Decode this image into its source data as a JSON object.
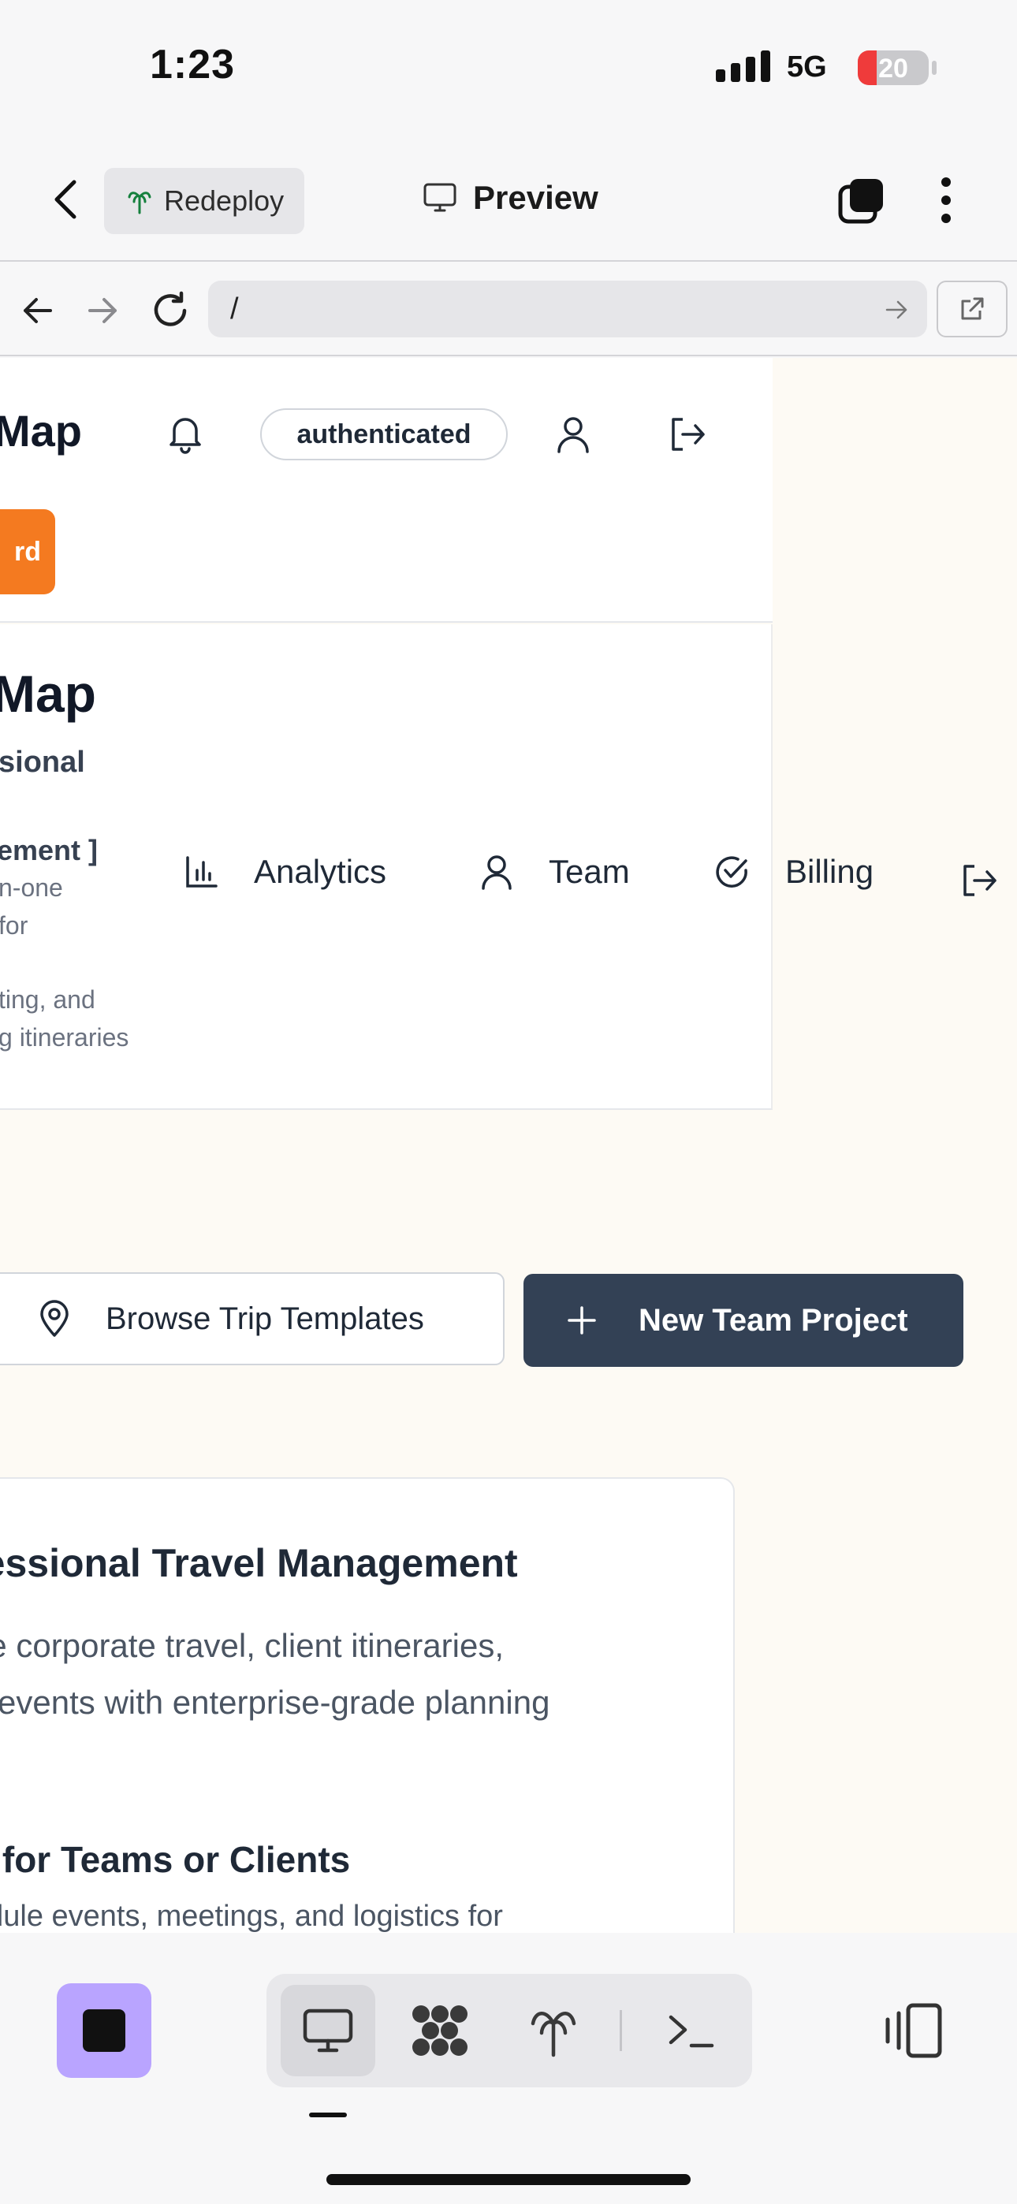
{
  "status_bar": {
    "time": "1:23",
    "network": "5G",
    "battery": "20"
  },
  "header": {
    "redeploy_label": "Redeploy",
    "title": "Preview"
  },
  "browser": {
    "url": "/"
  },
  "site": {
    "brand": "Map",
    "auth_status": "authenticated",
    "dashboard_button": "rd"
  },
  "sidebar": {
    "title": "Map",
    "subtitle": "sional",
    "feature_label": "ement ]",
    "feature_lines": [
      "n-one",
      "for",
      "ting, and",
      "g itineraries"
    ],
    "nav_items": [
      {
        "label": "Analytics",
        "icon": "bar-chart-icon"
      },
      {
        "label": "Team",
        "icon": "user-icon"
      },
      {
        "label": "Billing",
        "icon": "check-circle-icon"
      }
    ]
  },
  "actions": {
    "browse_label": "Browse Trip Templates",
    "new_project_label": "New Team Project"
  },
  "hero": {
    "title": "fessional Travel Management",
    "desc_line1": "he corporate travel, client itineraries,",
    "desc_line2": "n events with enterprise-grade planning",
    "sub_title": "n for Teams or Clients",
    "sub_desc": "edule events, meetings, and logistics for"
  },
  "colors": {
    "accent_orange": "#f47a20",
    "primary_dark": "#334155",
    "stop_purple": "#b9a4ff",
    "page_bg": "#fdfaf4"
  }
}
